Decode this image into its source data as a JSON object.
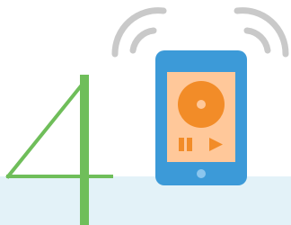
{
  "scene": {
    "digit": "4",
    "colors": {
      "background": "#ffffff",
      "ground": "#e3f2f8",
      "digit": "#6fbe5a",
      "signal_waves": "#c9c9c9",
      "phone_body": "#3c9ad8",
      "phone_screen": "#ffc89a",
      "media_accent": "#f28c28",
      "home_button": "#8cc6ee"
    },
    "icons": [
      "signal-waves-left-icon",
      "signal-waves-right-icon",
      "smartphone-icon",
      "music-disc-icon",
      "pause-icon",
      "play-icon",
      "home-button-icon"
    ]
  }
}
